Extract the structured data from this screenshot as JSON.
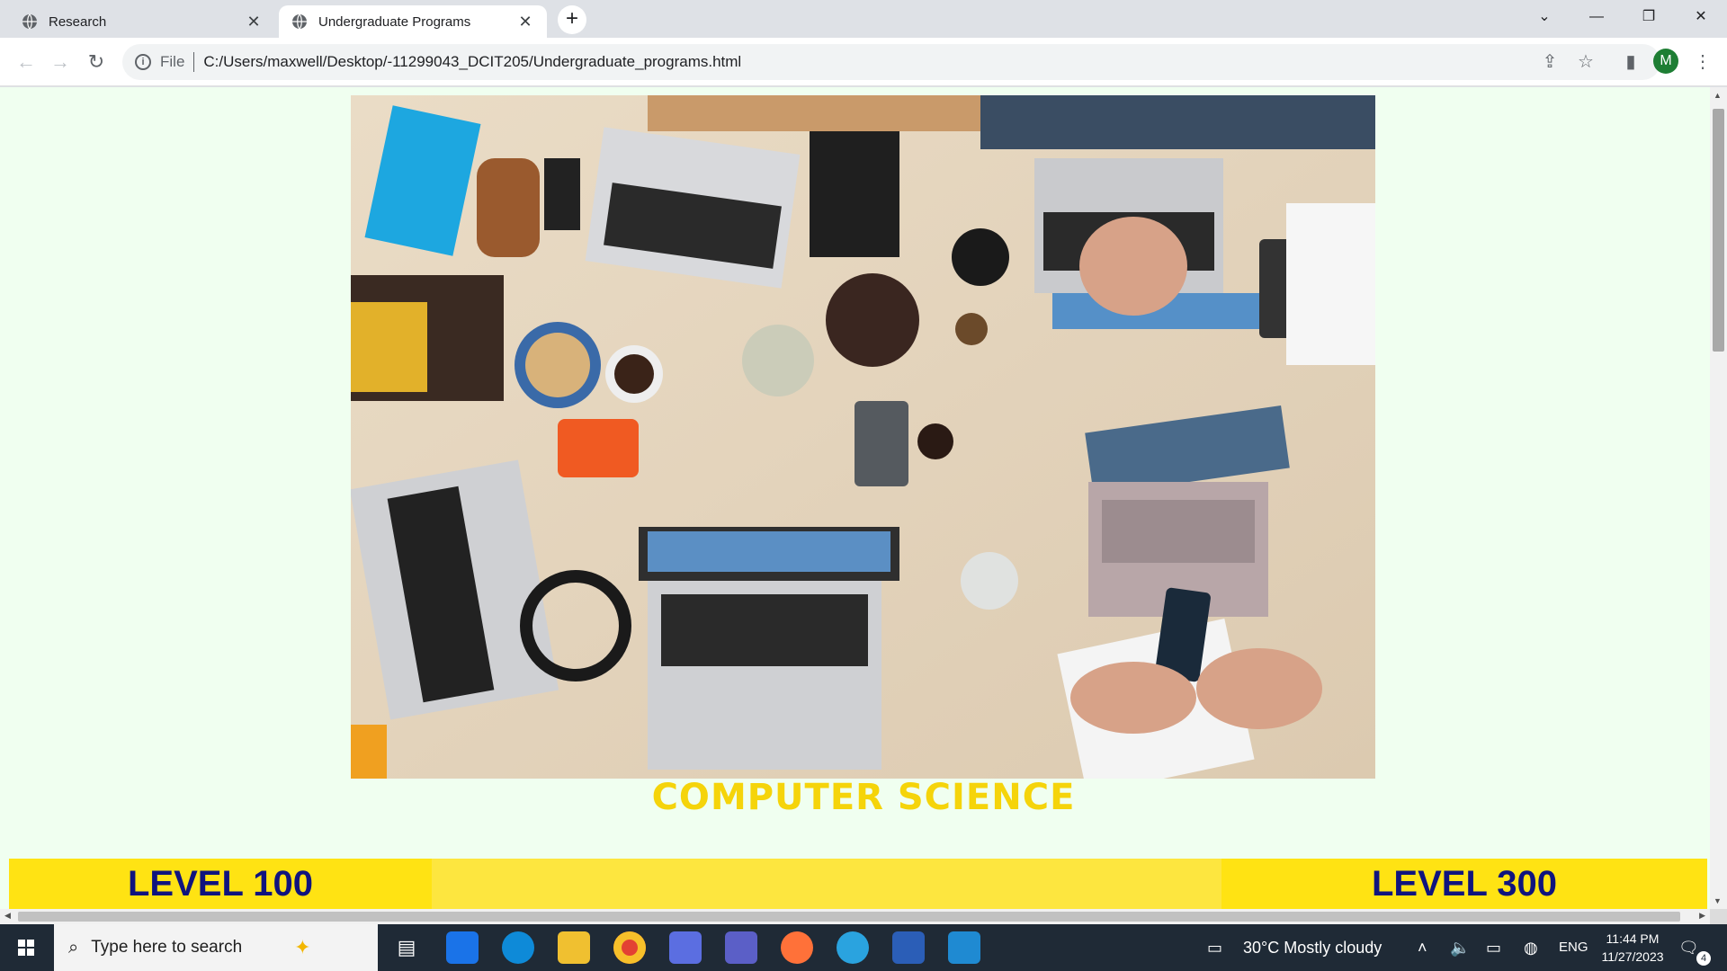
{
  "browser": {
    "tabs": [
      {
        "label": "Research",
        "icon": "globe-icon",
        "active": false
      },
      {
        "label": "Undergraduate Programs",
        "icon": "globe-icon",
        "active": true
      }
    ],
    "address": {
      "scheme": "File",
      "url": "C:/Users/maxwell/Desktop/-11299043_DCIT205/Undergraduate_programs.html"
    },
    "profile_initial": "M"
  },
  "page": {
    "department_title": "COMPUTER SCIENCE",
    "levels": [
      "LEVEL 100",
      "LEVEL 300"
    ],
    "colors": {
      "background": "#f0fff0",
      "title": "#f5d40a",
      "level_bar": "#fde63f",
      "level_cell": "#ffe313",
      "level_text": "#10147e"
    }
  },
  "taskbar": {
    "search_placeholder": "Type here to search",
    "weather": "30°C  Mostly cloudy",
    "language": "ENG",
    "time": "11:44 PM",
    "date": "11/27/2023",
    "notification_count": "4",
    "apps": [
      "task-view",
      "mail",
      "edge",
      "file-explorer",
      "chrome",
      "copilot",
      "teams",
      "firefox",
      "telegram",
      "word",
      "vscode"
    ]
  }
}
